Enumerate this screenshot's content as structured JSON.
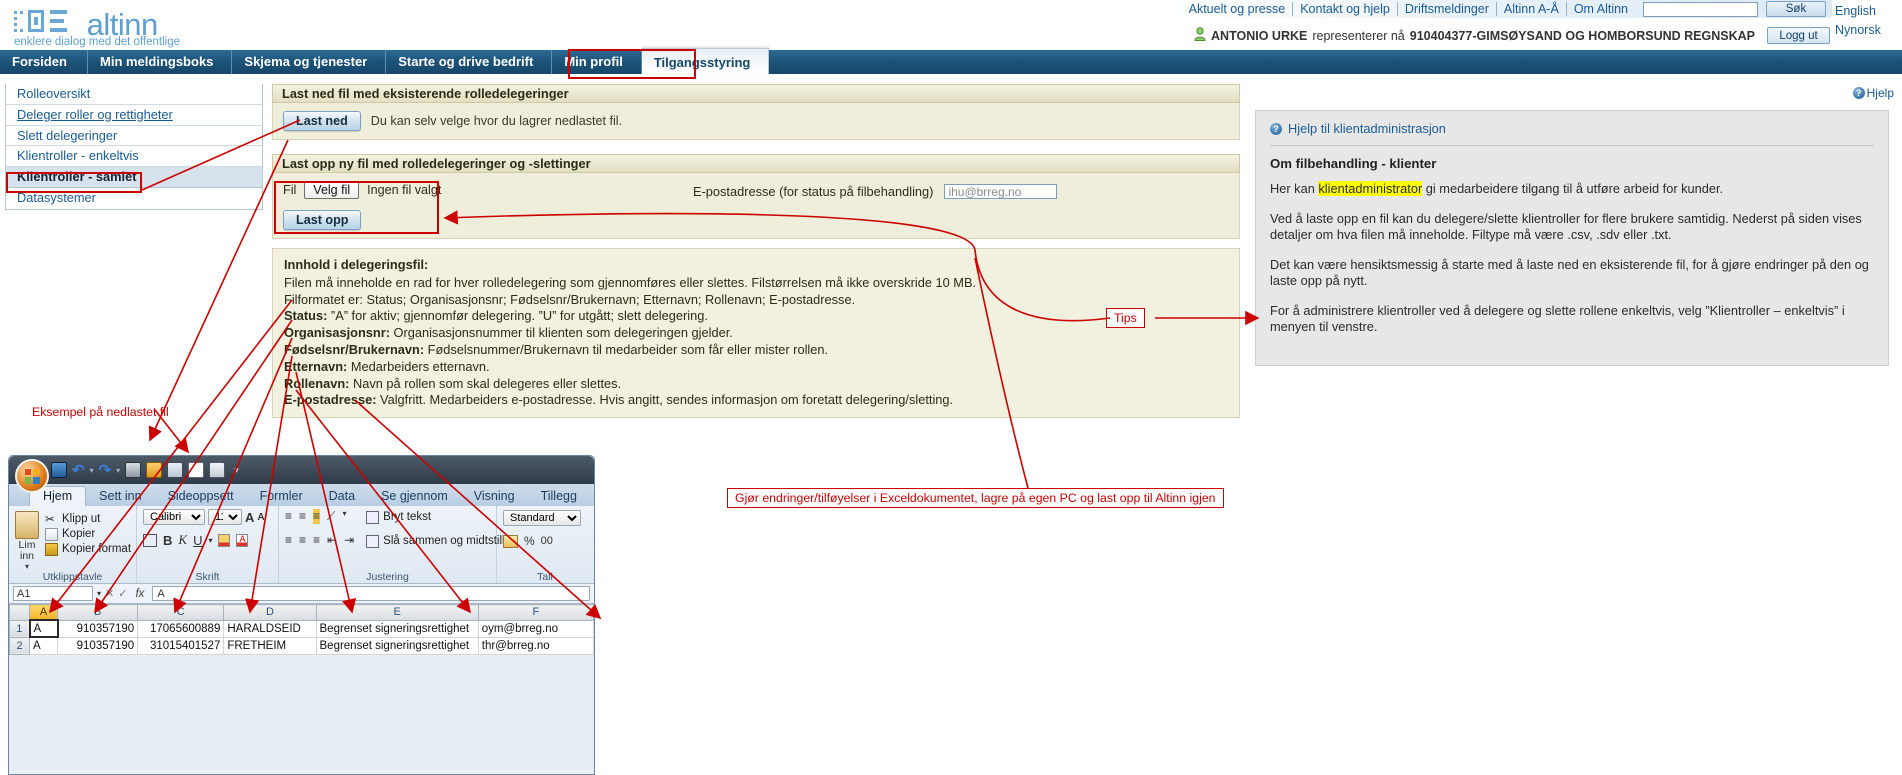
{
  "brand": {
    "name": "altinn",
    "tagline": "enklere dialog med det offentlige"
  },
  "top_links": [
    {
      "label": "Aktuelt og presse"
    },
    {
      "label": "Kontakt og hjelp"
    },
    {
      "label": "Driftsmeldinger"
    },
    {
      "label": "Altinn A-Å"
    },
    {
      "label": "Om Altinn"
    }
  ],
  "search": {
    "value": "",
    "button": "Søk"
  },
  "languages": [
    {
      "label": "English"
    },
    {
      "label": "Nynorsk"
    }
  ],
  "user": {
    "name": "ANTONIO URKE",
    "represents_text": "representerer nå",
    "org": "910404377-GIMSØYSAND OG HOMBORSUND REGNSKAP",
    "logout": "Logg ut"
  },
  "nav_tabs": [
    {
      "label": "Forsiden",
      "active": false
    },
    {
      "label": "Min meldingsboks",
      "active": false
    },
    {
      "label": "Skjema og tjenester",
      "active": false
    },
    {
      "label": "Starte og drive bedrift",
      "active": false
    },
    {
      "label": "Min profil",
      "active": false
    },
    {
      "label": "Tilgangsstyring",
      "active": true
    }
  ],
  "sidebar": {
    "items": [
      {
        "label": "Rolleoversikt",
        "style": "plain"
      },
      {
        "label": "Deleger roller og rettigheter",
        "style": "link"
      },
      {
        "label": "Slett delegeringer",
        "style": "plain"
      },
      {
        "label": "Klientroller - enkeltvis",
        "style": "plain"
      },
      {
        "label": "Klientroller - samlet",
        "style": "current"
      },
      {
        "label": "Datasystemer",
        "style": "plain"
      }
    ]
  },
  "download_panel": {
    "heading": "Last ned fil med eksisterende rolledelegeringer",
    "button": "Last ned",
    "hint": "Du kan selv velge hvor du lagrer nedlastet fil."
  },
  "upload_panel": {
    "heading": "Last opp ny fil med rolledelegeringer og -slettinger",
    "file_label": "Fil",
    "choose_button": "Velg fil",
    "no_file_text": "Ingen fil valgt",
    "email_label": "E-postadresse (for status på filbehandling)",
    "email_value": "ihu@brreg.no",
    "upload_button": "Last opp"
  },
  "info_box": {
    "title": "Innhold i delegeringsfil:",
    "lines": [
      {
        "bold": "",
        "text": "Filen må inneholde en rad for hver rolledelegering som gjennomføres eller slettes. Filstørrelsen må ikke overskride 10 MB."
      },
      {
        "bold": "",
        "text": "Filformatet er: Status; Organisasjonsnr; Fødselsnr/Brukernavn; Etternavn; Rollenavn; E-postadresse."
      },
      {
        "bold": "Status:",
        "text": " ”A” for aktiv; gjennomfør delegering. ”U” for utgått; slett delegering."
      },
      {
        "bold": "Organisasjonsnr:",
        "text": " Organisasjonsnummer til klienten som delegeringen gjelder."
      },
      {
        "bold": "Fødselsnr/Brukernavn:",
        "text": " Fødselsnummer/Brukernavn til medarbeider som får eller mister rollen."
      },
      {
        "bold": "Etternavn:",
        "text": " Medarbeiders etternavn."
      },
      {
        "bold": "Rollenavn:",
        "text": " Navn på rollen som skal delegeres eller slettes."
      },
      {
        "bold": "E-postadresse:",
        "text": " Valgfritt. Medarbeiders e-postadresse. Hvis angitt, sendes informasjon om foretatt delegering/sletting."
      }
    ]
  },
  "help": {
    "top_link": "Hjelp",
    "panel_link": "Hjelp til klientadministrasjon",
    "heading": "Om filbehandling - klienter",
    "paragraphs": [
      {
        "pre": "Her kan ",
        "highlight": "klientadministrator",
        "post": " gi medarbeidere tilgang til å utføre arbeid for kunder."
      },
      {
        "pre": "Ved å laste opp en fil kan du delegere/slette klientroller for flere brukere samtidig. Nederst på siden vises detaljer om hva filen må inneholde. Filtype må være .csv, .sdv eller .txt.",
        "highlight": "",
        "post": ""
      },
      {
        "pre": "Det kan være hensiktsmessig å starte med å laste ned en eksisterende fil, for å gjøre endringer på den og laste opp på nytt.",
        "highlight": "",
        "post": ""
      },
      {
        "pre": "For å administrere klientroller ved å delegere og slette rollene enkeltvis, velg ”Klientroller – enkeltvis” i menyen til venstre.",
        "highlight": "",
        "post": ""
      }
    ]
  },
  "excel": {
    "tabs": [
      {
        "label": "Hjem",
        "active": true
      },
      {
        "label": "Sett inn",
        "active": false
      },
      {
        "label": "Sideoppsett",
        "active": false
      },
      {
        "label": "Formler",
        "active": false
      },
      {
        "label": "Data",
        "active": false
      },
      {
        "label": "Se gjennom",
        "active": false
      },
      {
        "label": "Visning",
        "active": false
      },
      {
        "label": "Tillegg",
        "active": false
      }
    ],
    "clipboard": {
      "group_label": "Utklippstavle",
      "paste": "Lim inn",
      "cut": "Klipp ut",
      "copy": "Kopier",
      "format": "Kopier format"
    },
    "font": {
      "group_label": "Skrift",
      "family": "Calibri",
      "size": "11"
    },
    "align": {
      "group_label": "Justering",
      "wrap": "Bryt tekst",
      "merge": "Slå sammen og midtstill"
    },
    "number": {
      "group_label": "Tall",
      "format": "Standard"
    },
    "namebox": "A1",
    "fx": "fx",
    "formula_value": "A",
    "columns": [
      "A",
      "B",
      "C",
      "D",
      "E",
      "F"
    ],
    "rows": [
      {
        "num": "1",
        "cells": [
          "A",
          "910357190",
          "17065600889",
          "HARALDSEID",
          "Begrenset signeringsrettighet",
          "oym@brreg.no"
        ]
      },
      {
        "num": "2",
        "cells": [
          "A",
          "910357190",
          "31015401527",
          "FRETHEIM",
          "Begrenset signeringsrettighet",
          "thr@brreg.no"
        ]
      }
    ]
  },
  "annotations": {
    "example_file": "Eksempel på nedlastet fil",
    "tips": "Tips",
    "excel_note": "Gjør endringer/tilføyelser i Exceldokumentet, lagre på egen PC og last opp til Altinn igjen"
  }
}
